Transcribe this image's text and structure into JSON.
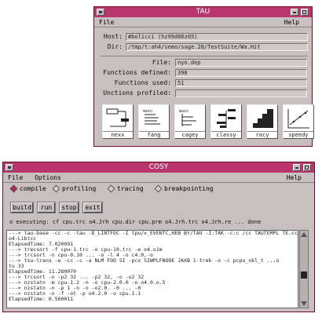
{
  "tau_window": {
    "title": "TAU",
    "menu": {
      "file": "File",
      "help_right": "Help"
    },
    "fields": [
      {
        "label": "Host:",
        "value": "#bolicci (hz99d06z05)"
      },
      {
        "label": "Dir:",
        "value": "/tmp/t:ah4/semo/sage.28/TestSuite/Wa.Hit"
      },
      {
        "label": "File:",
        "value": "nyn.dep"
      },
      {
        "label": "Functions defined:",
        "value": "398"
      },
      {
        "label": "Functions used:",
        "value": "51"
      },
      {
        "label": "Unctions profiled:",
        "value": ""
      }
    ],
    "tools": [
      "nexx",
      "fang",
      "cagey",
      "classy",
      "racy",
      "speedy"
    ]
  },
  "cosy_window": {
    "title": "COSY",
    "menu": {
      "file": "File",
      "options": "Options",
      "help_right": "Help"
    },
    "modes": [
      {
        "label": "compile",
        "selected": true
      },
      {
        "label": "profiling",
        "selected": false
      },
      {
        "label": "tracing",
        "selected": false
      },
      {
        "label": "breakpointing",
        "selected": false
      }
    ],
    "buttons": [
      "build",
      "run",
      "stop",
      "exit"
    ],
    "status": "o executing: cf cpu.trc o4.Jrh cpu.dir cpu.prm o4.Jrh.trc o4.Jrh.re ... done",
    "console_lines": [
      "---> tau-base -cc -c -tau -D_LINTFOC -I tpu/x_EVENTC,HEB BY/TAU -I:TAK -c:c /cc TAUTEMPL TE.cc",
      "    o4-Libtcc",
      "ElapsedTime: 7.020091",
      "---> trecsort -f cpu-1.trc -o cpu-10.trc -e o4.o1m",
      "---> trcsort -n cpu-0.10 ... -o -l 4 -o c4.0,-o",
      "---> tsu-trans -e -cc -c -a NLM FOO SI -pcx SIWPLFNODE JAXB 1-trek -o -c pcpu_nkl_t ...o",
      "tu 33",
      "ElapsedTime: 11.280070",
      "---> trcsort -n -p2 32 ... -p2 32, -o -o2 32",
      "---> nzstatn -m cpu-1.2 -n -o cpu-2.0.0 -o o4.0.o.5",
      "---> nzstatn -n -p 1 -n -o -o2.0. -0 ... -0",
      "---> nzstatn -n -f -ot -p o4.2.0 -o cpu.1.1",
      "ElapsedTime: 0.560011"
    ]
  },
  "colors": {
    "titlebar": "#b8366d",
    "window_bg": "#c8c0c0",
    "radio_on": "#c02050"
  }
}
